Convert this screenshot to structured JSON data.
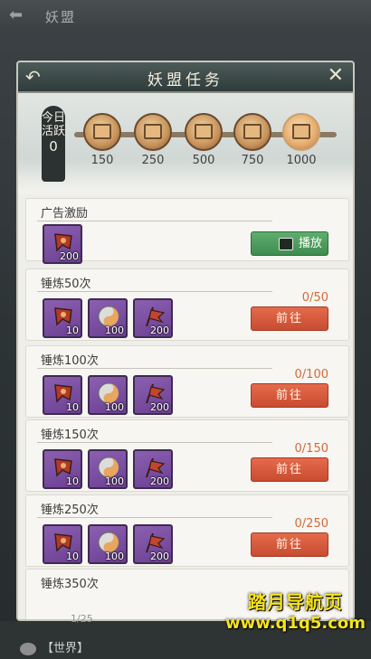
{
  "topbar": {
    "title": "妖盟"
  },
  "dialog": {
    "title": "妖盟任务",
    "activity": {
      "label_line1": "今日",
      "label_line2": "活跃",
      "value": "0",
      "milestones": [
        "150",
        "250",
        "500",
        "750",
        "1000"
      ]
    },
    "ad_task": {
      "name": "广告激励",
      "reward_qty": "200",
      "button_label": "播放"
    },
    "tasks": [
      {
        "name": "锤炼50次",
        "progress": "0/50",
        "rewards": [
          "10",
          "100",
          "200"
        ],
        "button_label": "前往"
      },
      {
        "name": "锤炼100次",
        "progress": "0/100",
        "rewards": [
          "10",
          "100",
          "200"
        ],
        "button_label": "前往"
      },
      {
        "name": "锤炼150次",
        "progress": "0/150",
        "rewards": [
          "10",
          "100",
          "200"
        ],
        "button_label": "前往"
      },
      {
        "name": "锤炼250次",
        "progress": "0/250",
        "rewards": [
          "10",
          "100",
          "200"
        ],
        "button_label": "前往"
      },
      {
        "name": "锤炼350次"
      }
    ]
  },
  "background": {
    "pager": "1/25",
    "chat_label": "【世界】"
  },
  "watermark": {
    "line1": "踏月导航页",
    "line2": "www.q1q5.com"
  },
  "colors": {
    "go_button": "#d85a3d",
    "play_button": "#4d9c5c",
    "reward_bg": "#7a4ea3"
  }
}
